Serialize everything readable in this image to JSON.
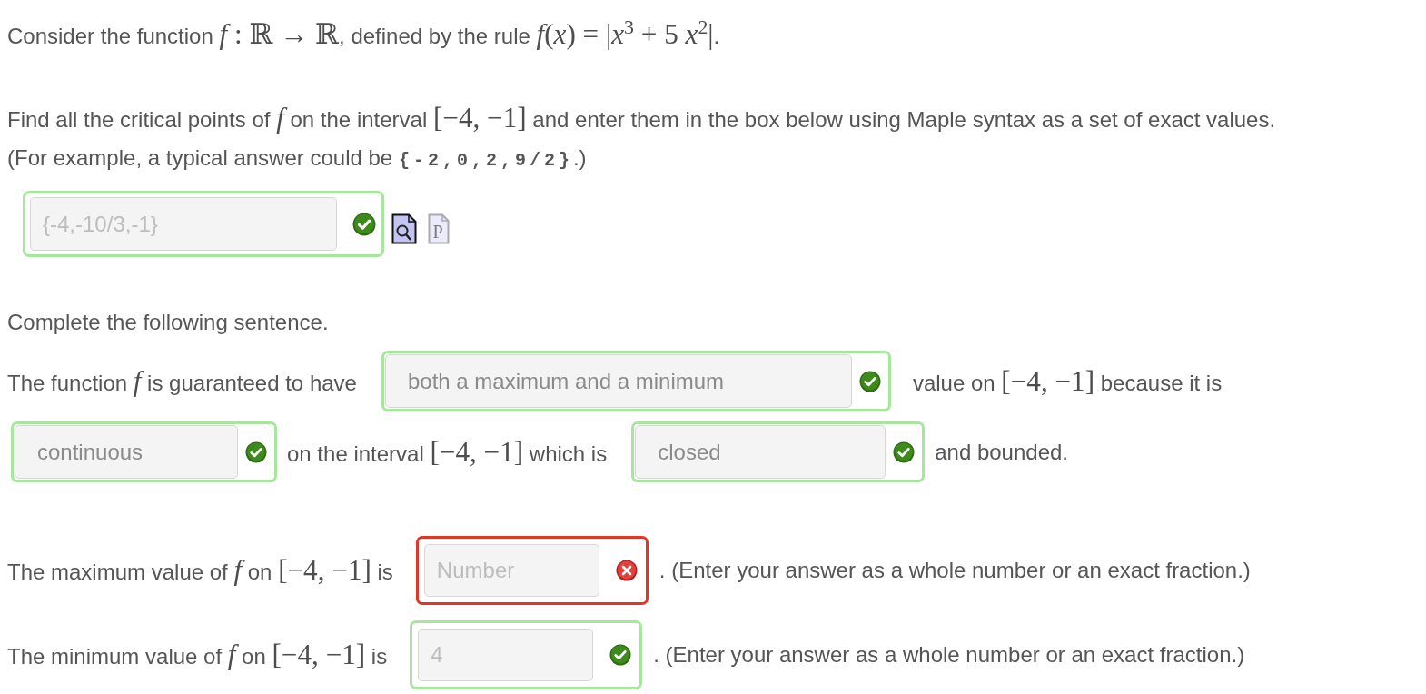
{
  "intro": [
    {
      "kind": "text",
      "text": "Consider the function "
    },
    {
      "kind": "math",
      "text": "*f* : ℝ → ℝ"
    },
    {
      "kind": "text",
      "text": ", defined by the rule "
    },
    {
      "kind": "math",
      "text": "*f*(*x*) = |*x*$^{3}$ + 5 *x*$^{2}$|"
    },
    {
      "kind": "text",
      "text": "."
    }
  ],
  "part_1": {
    "prompt": [
      {
        "kind": "text",
        "text": "Find all the critical points of "
      },
      {
        "kind": "math",
        "text": "*f*"
      },
      {
        "kind": "text",
        "text": " on the interval "
      },
      {
        "kind": "math",
        "text": "[−4, −1]"
      },
      {
        "kind": "text",
        "text": " and enter them in the box below using Maple syntax as a set of exact values."
      }
    ],
    "example": [
      {
        "kind": "text",
        "text": "(For example, a typical answer could be "
      },
      {
        "kind": "code",
        "text": "{-2,0,2,9/2}"
      },
      {
        "kind": "text",
        "text": ".)"
      }
    ],
    "answer": {
      "kind": "text",
      "value": "{-4,-10/3,-1}",
      "correct": true
    },
    "tools": [
      {
        "kind": "preview",
        "disabled": false
      },
      {
        "kind": "plot",
        "letter": "P",
        "disabled": true
      }
    ]
  },
  "part_2": {
    "instruction": [
      {
        "kind": "text",
        "text": "Complete the following sentence."
      }
    ],
    "sentence": [
      {
        "kind": "words",
        "segments": [
          {
            "kind": "text",
            "text": "The function "
          },
          {
            "kind": "math",
            "text": "*f*"
          },
          {
            "kind": "text",
            "text": " is guaranteed to have"
          }
        ]
      },
      {
        "kind": "blank",
        "answer": {
          "kind": "select",
          "value": "both a maximum and a minimum",
          "correct": true
        }
      },
      {
        "kind": "words",
        "segments": [
          {
            "kind": "text",
            "text": "value on "
          },
          {
            "kind": "math",
            "text": "[−4, −1]"
          },
          {
            "kind": "text",
            "text": " because it is"
          }
        ]
      },
      {
        "kind": "blank",
        "answer": {
          "kind": "select",
          "value": "continuous",
          "correct": true
        }
      },
      {
        "kind": "words",
        "segments": [
          {
            "kind": "text",
            "text": "on the interval "
          },
          {
            "kind": "math",
            "text": "[−4, −1]"
          },
          {
            "kind": "text",
            "text": " which is"
          }
        ]
      },
      {
        "kind": "blank",
        "answer": {
          "kind": "select",
          "value": "closed",
          "correct": true
        }
      },
      {
        "kind": "words",
        "segments": [
          {
            "kind": "text",
            "text": "and bounded."
          }
        ]
      }
    ]
  },
  "part_3": [
    {
      "prompt": [
        {
          "kind": "text",
          "text": "The maximum value of "
        },
        {
          "kind": "math",
          "text": "*f*"
        },
        {
          "kind": "text",
          "text": " on "
        },
        {
          "kind": "math",
          "text": "[−4, −1]"
        },
        {
          "kind": "text",
          "text": " is"
        }
      ],
      "answer": {
        "kind": "text",
        "placeholder": "Number",
        "correct": false
      },
      "hint": ". (Enter your answer as a whole number or an exact fraction.)"
    },
    {
      "prompt": [
        {
          "kind": "text",
          "text": "The minimum value of "
        },
        {
          "kind": "math",
          "text": "*f*"
        },
        {
          "kind": "text",
          "text": " on "
        },
        {
          "kind": "math",
          "text": "[−4, −1]"
        },
        {
          "kind": "text",
          "text": " is"
        }
      ],
      "answer": {
        "kind": "text",
        "value": "4",
        "correct": true
      },
      "hint": ". (Enter your answer as a whole number or an exact fraction.)"
    }
  ]
}
